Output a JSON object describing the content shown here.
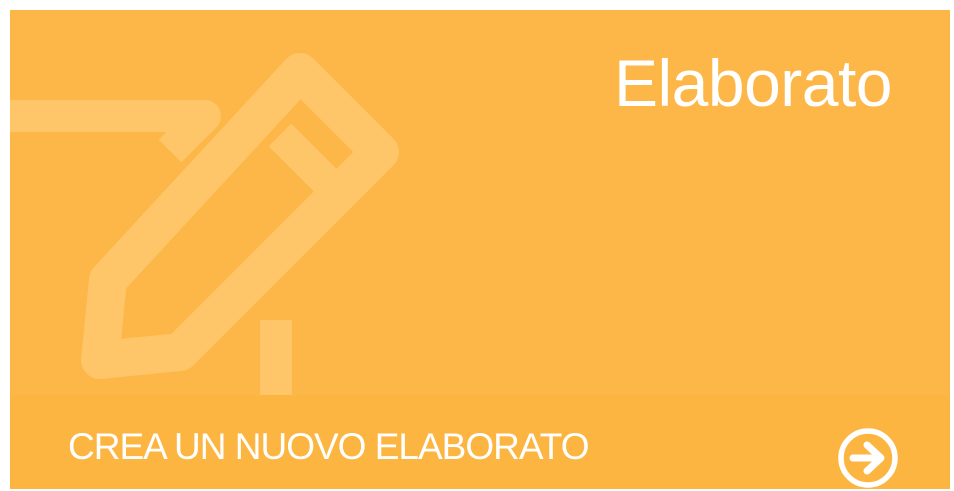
{
  "card": {
    "title": "Elaborato",
    "cta_label": "CREA UN NUOVO ELABORATO",
    "background_icon": "pencil-icon",
    "action_icon": "arrow-right-circle-icon"
  },
  "colors": {
    "background": "#FDB748",
    "footer": "#FDB542",
    "icon_watermark": "#FEC569",
    "text": "#FFFFFF"
  }
}
